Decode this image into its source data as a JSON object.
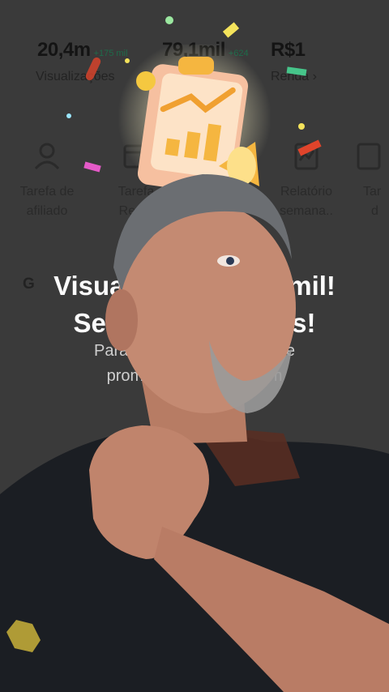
{
  "stats": [
    {
      "value": "20,4m",
      "delta": "+175 mil",
      "label": "Visualizações"
    },
    {
      "value": "79,1mil",
      "delta": "+624",
      "label": ""
    },
    {
      "value": "R$1",
      "delta": "",
      "label": "Renda ›"
    }
  ],
  "tools": [
    {
      "line1": "Tarefa de",
      "line2": "afiliado",
      "icon": "person-badge-icon"
    },
    {
      "line1": "Tarefa",
      "line2": "Remu",
      "icon": "calendar-icon"
    },
    {
      "line1": "",
      "line2": "",
      "icon": "tool-icon"
    },
    {
      "line1": "Relatório",
      "line2": "semana..",
      "icon": "report-icon"
    },
    {
      "line1": "Tar",
      "line2": "d",
      "icon": "task-icon"
    }
  ],
  "section_partial": "G",
  "modal": {
    "title_line1": "Visua                    0mil!",
    "title_line2": "Se                         s!",
    "message_line1": "Parabe                          o de",
    "message_line2": "promoç                    bom",
    "details_label": "lhes"
  },
  "colors": {
    "accent": "#e0442b",
    "positive": "#1e6b4a",
    "overlay": "#3a3a3a"
  }
}
